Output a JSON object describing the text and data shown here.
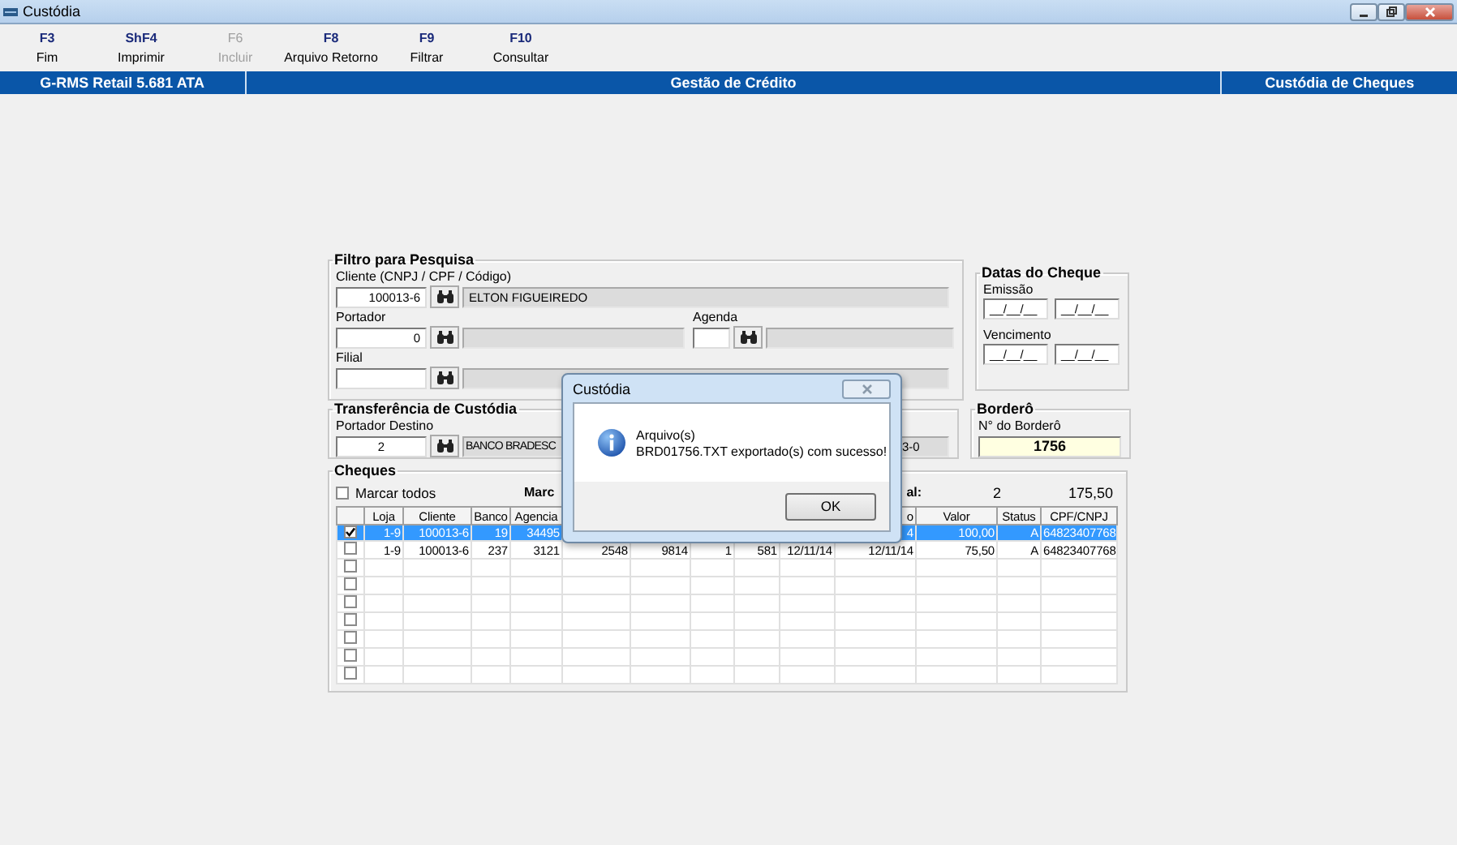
{
  "window": {
    "title": "Custódia"
  },
  "toolbar": [
    {
      "key": "F3",
      "label": "Fim",
      "disabled": false
    },
    {
      "key": "ShF4",
      "label": "Imprimir",
      "disabled": false
    },
    {
      "key": "F6",
      "label": "Incluir",
      "disabled": true
    },
    {
      "key": "F8",
      "label": "Arquivo Retorno",
      "disabled": false
    },
    {
      "key": "F9",
      "label": "Filtrar",
      "disabled": false
    },
    {
      "key": "F10",
      "label": "Consultar",
      "disabled": false
    }
  ],
  "header_bar": [
    "G-RMS Retail 5.681 ATA",
    "Gestão de Crédito",
    "Custódia de Cheques"
  ],
  "filter": {
    "title": "Filtro para Pesquisa",
    "cliente_label": "Cliente (CNPJ / CPF / Código)",
    "cliente_value": "100013-6",
    "cliente_name": "ELTON FIGUEIREDO",
    "portador_label": "Portador",
    "portador_value": "0",
    "agenda_label": "Agenda",
    "filial_label": "Filial"
  },
  "dates": {
    "title": "Datas do Cheque",
    "emissao_label": "Emissão",
    "emissao": [
      "__/__/__",
      "__/__/__"
    ],
    "vencimento_label": "Vencimento",
    "vencimento": [
      "__/__/__",
      "__/__/__"
    ]
  },
  "transfer": {
    "title": "Transferência de Custódia",
    "portador_destino_label": "Portador Destino",
    "portador_destino_value": "2",
    "bank_name": "BANCO BRADESC",
    "field_2": "3-0"
  },
  "bordero": {
    "title": "Borderô",
    "number_label": "N° do Borderô",
    "number": "1756"
  },
  "cheques": {
    "title": "Cheques",
    "mark_all": {
      "label": "Marcar todos",
      "checked": false
    },
    "marked_label": "Marc",
    "total_label": "al:",
    "total_count": "2",
    "total_value": "175,50",
    "columns": [
      "Loja",
      "Cliente",
      "Banco",
      "Agencia",
      null,
      null,
      null,
      null,
      null,
      "o",
      "Valor",
      "Status",
      "CPF/CNPJ"
    ],
    "rows": [
      {
        "checked": true,
        "selected": true,
        "cells": [
          "1-9",
          "100013-6",
          "19",
          "34495",
          null,
          null,
          null,
          null,
          null,
          "4",
          "100,00",
          "A",
          "64823407768"
        ]
      },
      {
        "checked": false,
        "selected": false,
        "cells": [
          "1-9",
          "100013-6",
          "237",
          "3121",
          "2548",
          "9814",
          "1",
          "581",
          "12/11/14",
          "12/11/14",
          "75,50",
          "A",
          "64823407768"
        ]
      },
      {
        "checked": false,
        "selected": false
      },
      {
        "checked": false,
        "selected": false
      },
      {
        "checked": false,
        "selected": false
      },
      {
        "checked": false,
        "selected": false
      },
      {
        "checked": false,
        "selected": false
      },
      {
        "checked": false,
        "selected": false
      },
      {
        "checked": false,
        "selected": false
      }
    ]
  },
  "dialog": {
    "title": "Custódia",
    "lines": [
      "Arquivo(s)",
      "BRD01756.TXT exportado(s) com sucesso!"
    ],
    "button": "OK"
  }
}
